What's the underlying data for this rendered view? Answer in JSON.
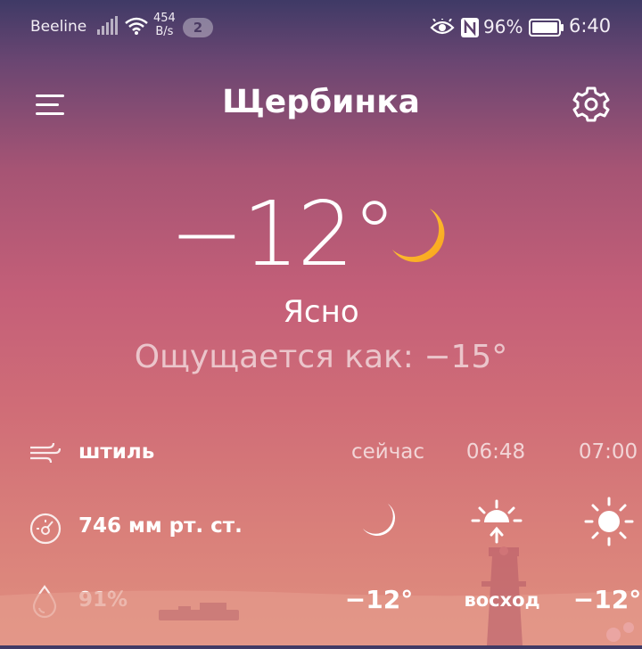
{
  "status_bar": {
    "carrier": "Beeline",
    "net_speed_value": "454",
    "net_speed_unit": "B/s",
    "notif_count": "2",
    "battery": "96%",
    "time": "6:40"
  },
  "header": {
    "city": "Щербинка"
  },
  "current": {
    "temperature": "−12°",
    "condition": "Ясно",
    "feels_like": "Ощущается как: −15°"
  },
  "details": {
    "wind": "штиль",
    "pressure": "746 мм рт. ст.",
    "humidity": "91%"
  },
  "hourly": [
    {
      "time": "сейчас",
      "icon": "moon-icon",
      "value": "−12°"
    },
    {
      "time": "06:48",
      "icon": "sunrise-icon",
      "value": "восход"
    },
    {
      "time": "07:00",
      "icon": "sun-icon",
      "value": "−12°"
    }
  ],
  "colors": {
    "moon": "#fdb827",
    "background_top": "#3f3a66",
    "background_bottom": "#e08f7f"
  }
}
